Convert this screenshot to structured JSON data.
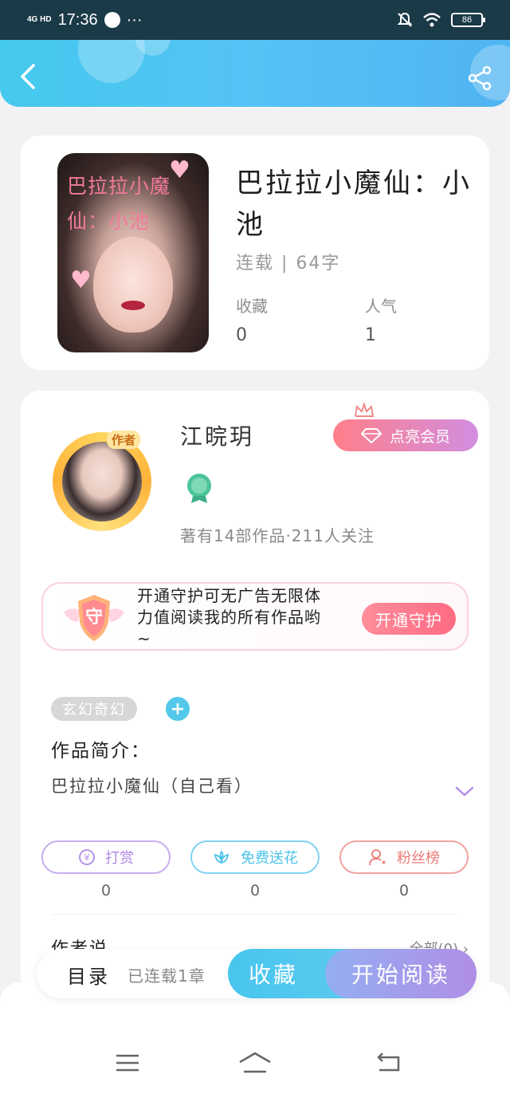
{
  "status_bar": {
    "network": "4G HD",
    "time": "17:36",
    "more": "···",
    "battery": "86"
  },
  "header": {
    "back_icon": "chevron-left-icon",
    "share_icon": "share-icon"
  },
  "book": {
    "cover_text_line1": "巴拉拉小魔",
    "cover_text_line2": "仙：小池",
    "title": "巴拉拉小魔仙：小池",
    "status": "连载 | 64字",
    "stats": [
      {
        "label": "收藏",
        "value": "0"
      },
      {
        "label": "人气",
        "value": "1"
      }
    ]
  },
  "author": {
    "badge": "作者",
    "name": "江晥玥",
    "vip_button": "点亮会员",
    "works_info": "著有14部作品·211人关注"
  },
  "guard": {
    "badge_text": "守",
    "text": "开通守护可无广告无限体力值阅读我的所有作品哟~",
    "button": "开通守护"
  },
  "tags": {
    "genre": "玄幻奇幻",
    "add": "+"
  },
  "intro": {
    "heading": "作品简介：",
    "text": "巴拉拉小魔仙（自己看）"
  },
  "actions": [
    {
      "label": "打赏",
      "icon": "yen-coin-icon",
      "count": "0",
      "color": "#b088e6"
    },
    {
      "label": "免费送花",
      "icon": "flower-icon",
      "count": "0",
      "color": "#4cc4ea"
    },
    {
      "label": "粉丝榜",
      "icon": "fan-user-icon",
      "count": "0",
      "color": "#ea7c78"
    }
  ],
  "author_says": {
    "heading": "作者说",
    "all_link": "全部(0) ›"
  },
  "bottom_bar": {
    "catalog": "目录",
    "chapters": "已连载1章",
    "collect": "收藏",
    "read": "开始阅读"
  },
  "nav": [
    "menu-icon",
    "home-icon",
    "back-icon"
  ]
}
